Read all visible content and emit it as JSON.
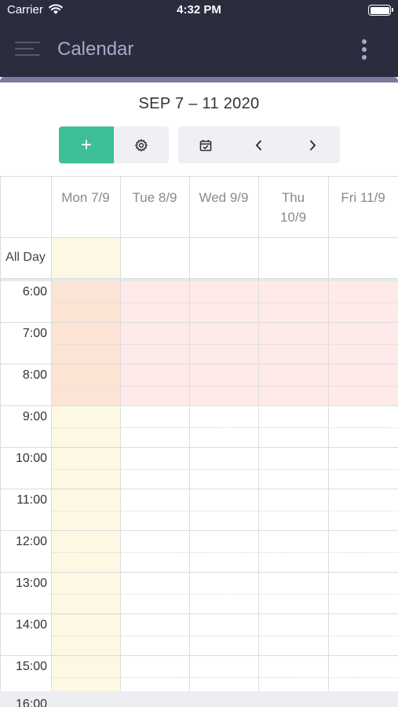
{
  "status_bar": {
    "carrier": "Carrier",
    "time": "4:32 PM"
  },
  "app_bar": {
    "title": "Calendar"
  },
  "calendar": {
    "range_title": "SEP 7 – 11 2020",
    "toolbar": {
      "add_label": "+"
    },
    "all_day_label": "All Day",
    "days": [
      {
        "line1": "Mon 7/9",
        "line2": ""
      },
      {
        "line1": "Tue 8/9",
        "line2": ""
      },
      {
        "line1": "Wed 9/9",
        "line2": ""
      },
      {
        "line1": "Thu",
        "line2": "10/9"
      },
      {
        "line1": "Fri 11/9",
        "line2": ""
      }
    ],
    "hours": [
      "6:00",
      "7:00",
      "8:00",
      "9:00",
      "10:00",
      "11:00",
      "12:00",
      "13:00",
      "14:00",
      "15:00"
    ],
    "next_hour_partial": "16:00",
    "unavailable_hours": [
      "6:00",
      "7:00",
      "8:00"
    ],
    "today_column": "Mon 7/9",
    "colors": {
      "app_bar": "#2b2c3e",
      "accent": "#7c7a9e",
      "add_button": "#3ebf9a",
      "today_highlight": "#fcf8e3",
      "unavailable": "#ffe9e9"
    }
  }
}
